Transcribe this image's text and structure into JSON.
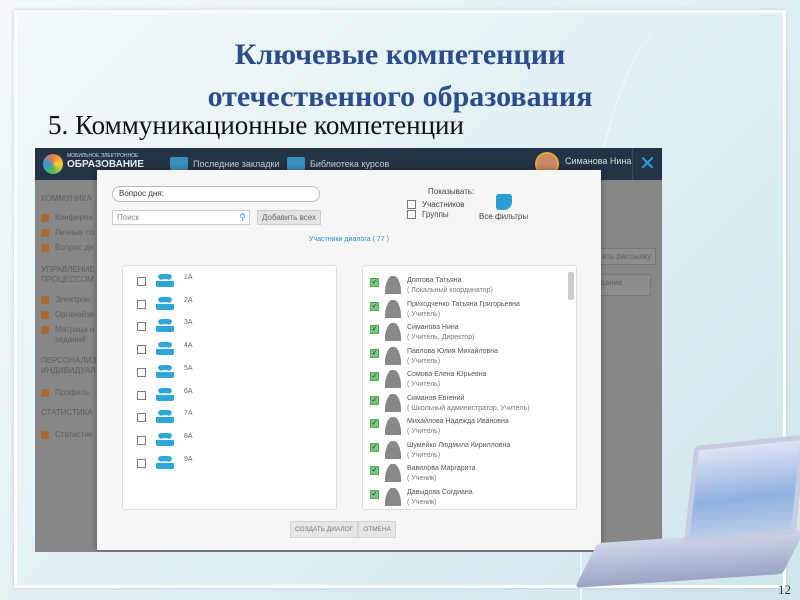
{
  "slide": {
    "title_line1": "Ключевые компетенции",
    "title_line2": "отечественного образования",
    "subtitle": "5. Коммуникационные компетенции",
    "page_number": "12"
  },
  "app": {
    "logo_small": "МОБИЛЬНОЕ ЭЛЕКТРОННОЕ",
    "logo_big": "ОБРАЗОВАНИЕ",
    "nav": [
      "Последние закладки",
      "Библиотека курсов"
    ],
    "user_name": "Симанова Нина",
    "close": "✕"
  },
  "sidebar": {
    "section1": "КОММУНИКА",
    "items1": [
      "Конферен",
      "Личные со",
      "Вопрос дн"
    ],
    "section2a": "УПРАВЛЕНИЕ",
    "section2b": "ПРОЦЕССОМ",
    "items2": [
      "Электрон",
      "Органайзе",
      "Матрица н",
      "заданий"
    ],
    "section3a": "ПЕРСОНАЛИЗ",
    "section3b": "ИНДИВИДУАЛ",
    "items3": [
      "Профиль"
    ],
    "section4": "СТАТИСТИКА",
    "items4": [
      "Статистик"
    ]
  },
  "background_right": {
    "mailing": "ать рассылку",
    "task": "дание"
  },
  "dialog": {
    "question": "Вопрос дня:",
    "search_placeholder": "Поиск",
    "add_all": "Добавить всех",
    "show_label": "Показывать:",
    "opt_members": "Участников",
    "opt_groups": "Группы",
    "all_filters": "Все фильтры",
    "members_link": "Участники диалога ( 77 )",
    "groups": [
      "1А",
      "2А",
      "3А",
      "4А",
      "5А",
      "6А",
      "7А",
      "8А",
      "9А"
    ],
    "members": [
      {
        "name": "Долгова Татьяна",
        "role": "( Локальный координатор)"
      },
      {
        "name": "Приходченко Татьяна Григорьевна",
        "role": "( Учитель)"
      },
      {
        "name": "Симанова Нина",
        "role": "( Учитель, Директор)"
      },
      {
        "name": "Павлова Юлия Михайловна",
        "role": "( Учитель)"
      },
      {
        "name": "Сомова Елена Юрьевна",
        "role": "( Учитель)"
      },
      {
        "name": "Симанов Евгений",
        "role": "( Школьный администратор, Учитель)"
      },
      {
        "name": "Михайлова Надежда Ивановна",
        "role": "( Учитель)"
      },
      {
        "name": "Шумейко Людмила Кирилловна",
        "role": "( Учитель)"
      },
      {
        "name": "Вавилова Маргарита",
        "role": "( Ученик)"
      },
      {
        "name": "Давыдова Согдиана",
        "role": "( Ученик)"
      }
    ],
    "create": "СОЗДАТЬ ДИАЛОГ",
    "cancel": "ОТМЕНА"
  }
}
